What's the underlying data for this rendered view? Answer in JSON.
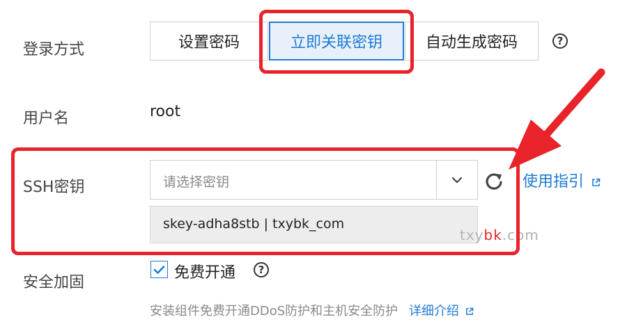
{
  "login": {
    "label": "登录方式",
    "options": [
      "设置密码",
      "立即关联密钥",
      "自动生成密码"
    ],
    "help": "?"
  },
  "username": {
    "label": "用户名",
    "value": "root"
  },
  "ssh": {
    "label": "SSH密钥",
    "placeholder": "请选择密钥",
    "selected_key": "skey-adha8stb | txybk_com",
    "guide_link": "使用指引"
  },
  "security": {
    "label": "安全加固",
    "checkbox_label": "免费开通",
    "help": "?",
    "note": "安装组件免费开通DDoS防护和主机安全防护",
    "details_link": "详细介绍"
  },
  "watermark": {
    "part1": "txy",
    "part2": "bk",
    "part3": ".com"
  },
  "colors": {
    "accent": "#1e7ad6",
    "highlight_red": "#e8232a"
  }
}
